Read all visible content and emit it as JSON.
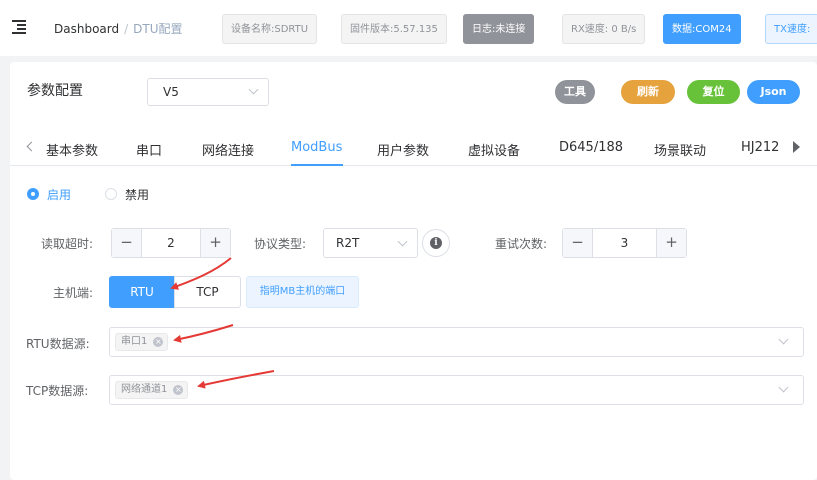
{
  "header": {
    "breadcrumb": {
      "root": "Dashboard",
      "separator": "/",
      "current": "DTU配置"
    },
    "tags": {
      "device_name": "设备名称:SDRTU",
      "firmware": "固件版本:5.57.135",
      "log_status": "日志:未连接",
      "rx_speed": "RX速度: 0 B/s",
      "data_port": "数据:COM24",
      "tx_speed": "TX速度:"
    }
  },
  "card": {
    "title": "参数配置",
    "version_select": "V5",
    "actions": {
      "tools": "工具",
      "refresh": "刷新",
      "reset": "复位",
      "json": "Json"
    }
  },
  "tabs": [
    "基本参数",
    "串口",
    "网络连接",
    "ModBus",
    "用户参数",
    "虚拟设备",
    "D645/188",
    "场景联动",
    "HJ212"
  ],
  "active_tab": "ModBus",
  "modbus": {
    "enable_label": "启用",
    "disable_label": "禁用",
    "enabled": true,
    "read_timeout": {
      "label": "读取超时:",
      "value": "2",
      "minus": "−",
      "plus": "+"
    },
    "protocol_type": {
      "label": "协议类型:",
      "value": "R2T",
      "info_icon": "i"
    },
    "retry_count": {
      "label": "重试次数:",
      "value": "3",
      "minus": "−",
      "plus": "+"
    },
    "master": {
      "label": "主机端:",
      "options": [
        "RTU",
        "TCP"
      ],
      "selected": "RTU",
      "hint": "指明MB主机的端口"
    },
    "rtu_source": {
      "label": "RTU数据源:",
      "chip": "串口1",
      "close": "×"
    },
    "tcp_source": {
      "label": "TCP数据源:",
      "chip": "网络通道1",
      "close": "×"
    }
  },
  "colors": {
    "primary": "#409eff",
    "warning": "#e6a23c",
    "success": "#67c23a",
    "info": "#909399",
    "arrow": "#e53935"
  }
}
